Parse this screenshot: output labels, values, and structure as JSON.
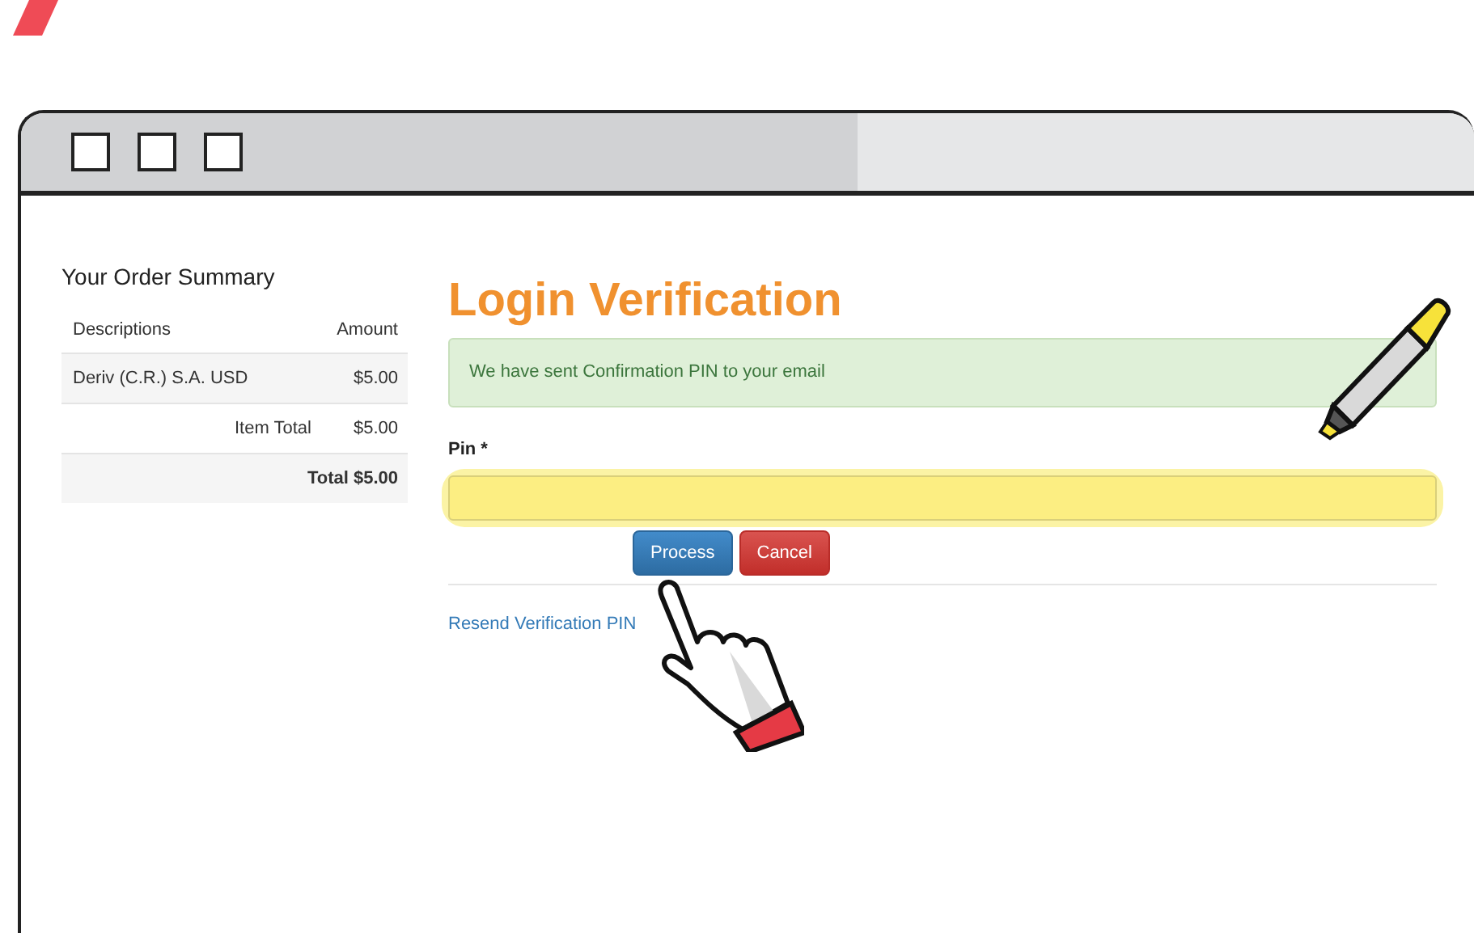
{
  "order_summary": {
    "title": "Your Order Summary",
    "columns": [
      "Descriptions",
      "Amount"
    ],
    "rows": [
      {
        "kind": "item",
        "label": "Deriv (C.R.) S.A. USD",
        "amount": "$5.00"
      },
      {
        "kind": "subtotal",
        "label": "Item Total",
        "amount": "$5.00"
      },
      {
        "kind": "total",
        "label": "Total $5.00"
      }
    ]
  },
  "verification": {
    "title": "Login Verification",
    "alert": "We have sent Confirmation PIN to your email",
    "pin_label": "Pin *",
    "pin_field": {
      "highlighted": true
    },
    "buttons": [
      {
        "label": "Process",
        "kind": "primary"
      },
      {
        "label": "Cancel",
        "kind": "danger"
      }
    ],
    "resend_link": "Resend Verification PIN"
  }
}
